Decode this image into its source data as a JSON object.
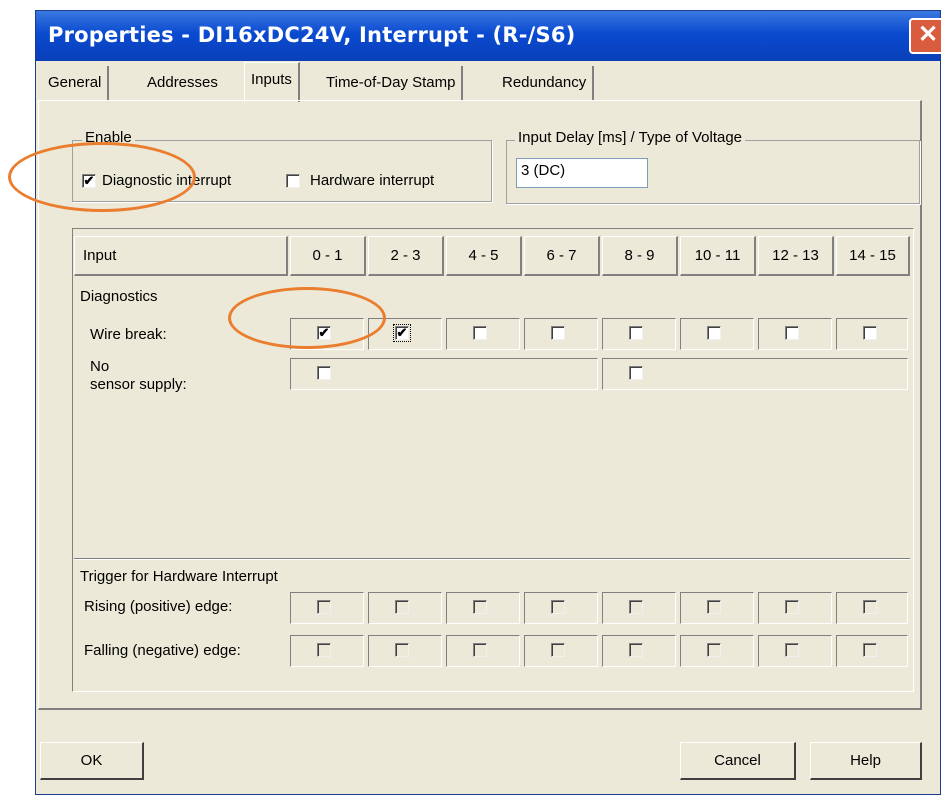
{
  "window": {
    "title": "Properties - DI16xDC24V, Interrupt - (R-/S6)",
    "close_glyph": "✕"
  },
  "tabs": [
    {
      "label": "General",
      "active": false
    },
    {
      "label": "Addresses",
      "active": false
    },
    {
      "label": "Inputs",
      "active": true
    },
    {
      "label": "Time-of-Day Stamp",
      "active": false
    },
    {
      "label": "Redundancy",
      "active": false
    }
  ],
  "enable": {
    "legend": "Enable",
    "diagnostic_interrupt": {
      "label": "Diagnostic interrupt",
      "checked": true
    },
    "hardware_interrupt": {
      "label": "Hardware interrupt",
      "checked": false
    }
  },
  "input_delay": {
    "legend": "Input Delay [ms] / Type of Voltage",
    "value": "3 (DC)"
  },
  "table": {
    "header_label": "Input",
    "columns": [
      "0 - 1",
      "2 - 3",
      "4 - 5",
      "6 - 7",
      "8 - 9",
      "10 - 11",
      "12 - 13",
      "14 - 15"
    ],
    "diagnostics_label": "Diagnostics",
    "wire_break": {
      "label": "Wire break:",
      "checked": [
        true,
        true,
        false,
        false,
        false,
        false,
        false,
        false
      ]
    },
    "no_sensor_supply": {
      "label_line1": "No",
      "label_line2": "sensor supply:",
      "checked": [
        false,
        false
      ]
    },
    "trigger_label": "Trigger for Hardware Interrupt",
    "rising_edge": {
      "label": "Rising (positive) edge:",
      "checked": [
        false,
        false,
        false,
        false,
        false,
        false,
        false,
        false
      ]
    },
    "falling_edge": {
      "label": "Falling (negative) edge:",
      "checked": [
        false,
        false,
        false,
        false,
        false,
        false,
        false,
        false
      ]
    }
  },
  "buttons": {
    "ok": "OK",
    "cancel": "Cancel",
    "help": "Help"
  },
  "check_glyph": "✔",
  "colors": {
    "title_bar": "#0a4ad0",
    "highlight_ring": "#ea7d2e",
    "dialog_bg": "#ece9d8"
  }
}
